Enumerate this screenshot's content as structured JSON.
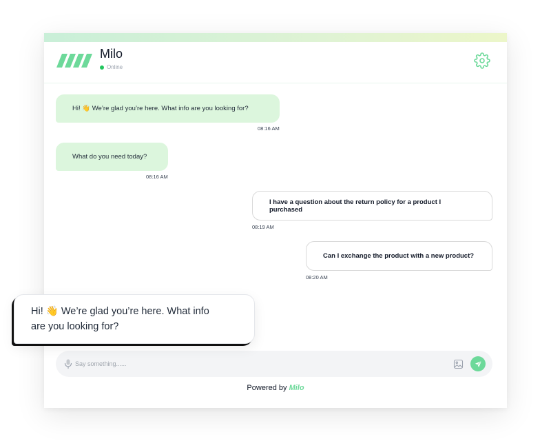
{
  "header": {
    "bot_name": "Milo",
    "status": "Online",
    "logo_icon": "milo-logo-icon",
    "settings_icon": "gear-icon"
  },
  "messages": [
    {
      "sender": "bot",
      "text": "Hi! 👋 We’re glad you’re here. What info are you looking for?",
      "time": "08:16 AM"
    },
    {
      "sender": "bot",
      "text": "What do you need today?",
      "time": "08:16 AM"
    },
    {
      "sender": "user",
      "text": "I have a question about the return policy for a product I purchased",
      "time": "08:19 AM"
    },
    {
      "sender": "user",
      "text": "Can  I exchange the product with a new product?",
      "time": "08:20 AM"
    }
  ],
  "composer": {
    "placeholder": "Say something......",
    "mic_icon": "microphone-icon",
    "image_icon": "image-icon",
    "send_icon": "send-icon"
  },
  "footer": {
    "powered_label": "Powered by",
    "brand": "Milo"
  },
  "popup": {
    "text": "Hi! 👋 We’re glad you’re here. What info are you looking for?"
  },
  "colors": {
    "accent": "#6dd99a",
    "bot_bubble": "#dcf6dd",
    "online": "#22c55e"
  }
}
